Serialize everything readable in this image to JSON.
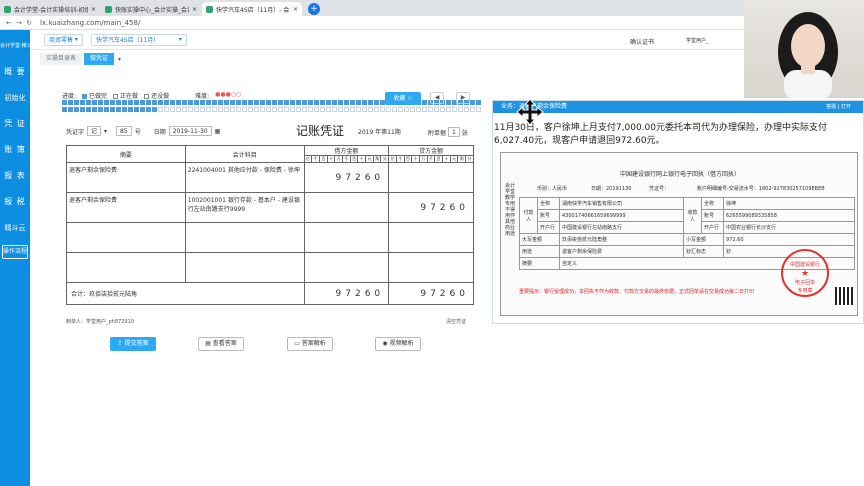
{
  "browser": {
    "tabs": [
      {
        "label": "会计学堂-会计实操培训-初级中级",
        "active": false
      },
      {
        "label": "快账实操中心_会计实操_会计模拟",
        "active": false
      },
      {
        "label": "快学汽车4S店（11月）- 会计做账",
        "active": true
      }
    ],
    "url": "lx.kuaizhang.com/main_458/"
  },
  "sidebar": {
    "brand": "会计学堂·精斗云",
    "items": [
      "概 要",
      "初始化",
      "凭 证",
      "账 簿",
      "报 表",
      "报 税",
      "精斗云"
    ],
    "flow_button": "操作流程"
  },
  "topnav": {
    "select1": "商贸零售",
    "select2": "快学汽车4S店（11月）",
    "cert": "确认证书",
    "user": "学堂用户_"
  },
  "subtabs": [
    "实操目录表",
    "做凭证"
  ],
  "progress": {
    "label": "进度:",
    "done": "已做完",
    "doing": "正在做",
    "undone": "还没做",
    "difficulty": "难度:",
    "collect": "收藏 ☆"
  },
  "voucher": {
    "type_label": "凭证字",
    "type_value": "记",
    "number": "85",
    "number_suffix": "号",
    "date_label": "日期",
    "date_value": "2019-11-30",
    "title": "记账凭证",
    "period": "2019 年第11期",
    "attach_label": "附单据",
    "attach_value": "1",
    "attach_suffix": "张",
    "col_desc": "摘要",
    "col_account": "会计科目",
    "col_debit": "借方金额",
    "col_credit": "贷方金额",
    "digits": [
      "亿",
      "千",
      "百",
      "十",
      "万",
      "千",
      "百",
      "十",
      "元",
      "角",
      "分"
    ],
    "rows": [
      {
        "desc": "退客户剩余保险费",
        "account": "2241004001 其他应付款 - 保险费 - 徐坤",
        "debit": "97260",
        "credit": ""
      },
      {
        "desc": "退客户剩余保险费",
        "account": "1002001001 银行存款 - 基本户 - 建设银行左站南路支行9999",
        "debit": "",
        "credit": "97260"
      },
      {
        "desc": "",
        "account": "",
        "debit": "",
        "credit": ""
      },
      {
        "desc": "",
        "account": "",
        "debit": "",
        "credit": ""
      }
    ],
    "total_label": "合计：玖佰柒拾贰元陆角",
    "total_debit": "97260",
    "total_credit": "97260",
    "maker": "制单人：学堂用户_ph872910",
    "clear": "清空凭证"
  },
  "actions": [
    "提交答案",
    "查看答案",
    "答案解析",
    "视频解析"
  ],
  "question": {
    "header": "业务：退客户剩余保险费",
    "header_right": "答题 | 打开",
    "text": "11月30日，客户徐坤上月支付7,000.00元委托本司代为办理保险，办理中实际支付6,027.40元，现客户申请退回972.60元。"
  },
  "receipt": {
    "title": "中国建设银行网上银行电子回执（借方回执）",
    "side": "会计学堂教学专用 不得用作其他商业用途",
    "city_label": "币别：人民币",
    "date": "日期：20191130",
    "voucher_no": "凭证号：",
    "serial": "账户明细编号-交易流水号：1802-927830257109EBEB",
    "payer_label": "付款人",
    "payer_name_label": "全称",
    "payer_name": "湖南快学汽车销售有限公司",
    "payer_acct_label": "账号",
    "payer_acct": "43001740661659699999",
    "payer_bank_label": "开户行",
    "payer_bank": "中国建设银行左站南路支行",
    "payee_label": "收款人",
    "payee_name_label": "全称",
    "payee_name": "徐坤",
    "payee_acct_label": "账号",
    "payee_acct": "6265599089335858",
    "payee_bank_label": "开户行",
    "payee_bank": "中国农业银行长沙支行",
    "amount_upper_label": "大写金额",
    "amount_upper": "玖佰柒拾贰元陆角整",
    "amount_lower_label": "小写金额",
    "amount_lower": "972.60",
    "purpose_label": "用途",
    "purpose": "退客户剩余保险费",
    "remit_label": "钞汇标志",
    "remit": "钞",
    "memo_label": "摘要",
    "memo": "自定义",
    "warn": "重要提示：银行受理成功，本回执不作为收款、付款方交易的最终依据，正式回单请在交易成功第二日打印",
    "seal_top": "中国建设银行",
    "seal_mid": "电子回单",
    "seal_bottom": "专用章"
  },
  "colors": {
    "sidebar": "#0e8ee0",
    "accent": "#2ea8f0",
    "blue_dot": "#4a9bd8"
  }
}
